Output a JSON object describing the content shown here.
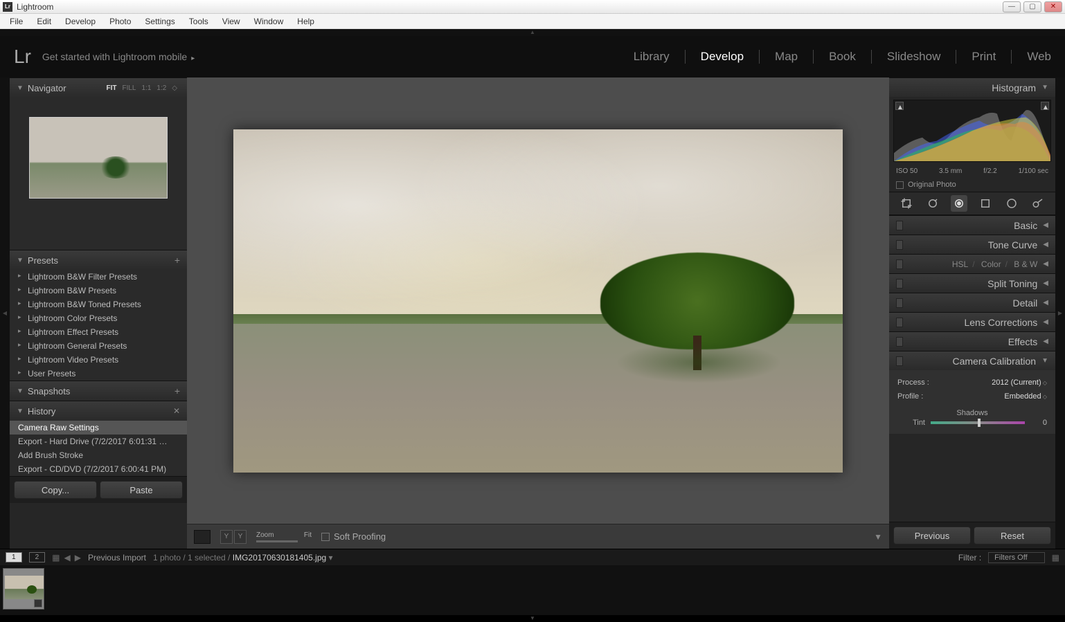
{
  "window": {
    "title": "Lightroom"
  },
  "menu": [
    "File",
    "Edit",
    "Develop",
    "Photo",
    "Settings",
    "Tools",
    "View",
    "Window",
    "Help"
  ],
  "topbar": {
    "logo": "Lr",
    "get_started": "Get started with Lightroom mobile",
    "modules": [
      "Library",
      "Develop",
      "Map",
      "Book",
      "Slideshow",
      "Print",
      "Web"
    ],
    "active_module": "Develop"
  },
  "left_panel": {
    "navigator": {
      "title": "Navigator",
      "zoom_options": [
        "FIT",
        "FILL",
        "1:1",
        "1:2"
      ],
      "active_zoom": "FIT"
    },
    "presets": {
      "title": "Presets",
      "items": [
        "Lightroom B&W Filter Presets",
        "Lightroom B&W Presets",
        "Lightroom B&W Toned Presets",
        "Lightroom Color Presets",
        "Lightroom Effect Presets",
        "Lightroom General Presets",
        "Lightroom Video Presets",
        "User Presets"
      ]
    },
    "snapshots": {
      "title": "Snapshots"
    },
    "history": {
      "title": "History",
      "items": [
        "Camera Raw Settings",
        "Export - Hard Drive (7/2/2017 6:01:31 …",
        "Add Brush Stroke",
        "Export - CD/DVD (7/2/2017 6:00:41 PM)"
      ],
      "active_index": 0
    },
    "buttons": {
      "copy": "Copy...",
      "paste": "Paste"
    }
  },
  "center": {
    "toolbar": {
      "zoom_label": "Zoom",
      "zoom_mode": "Fit",
      "soft_proofing": "Soft Proofing"
    }
  },
  "right_panel": {
    "histogram": {
      "title": "Histogram",
      "meta": {
        "iso": "ISO 50",
        "focal": "3.5 mm",
        "aperture": "f/2.2",
        "shutter": "1/100 sec"
      },
      "original_photo": "Original Photo"
    },
    "sections": {
      "basic": "Basic",
      "tone_curve": "Tone Curve",
      "hsl": "HSL",
      "color": "Color",
      "bw": "B & W",
      "split_toning": "Split Toning",
      "detail": "Detail",
      "lens_corrections": "Lens Corrections",
      "effects": "Effects",
      "camera_calibration": "Camera Calibration"
    },
    "calibration": {
      "process_label": "Process :",
      "process_value": "2012 (Current)",
      "profile_label": "Profile :",
      "profile_value": "Embedded",
      "shadows_label": "Shadows",
      "tint_label": "Tint",
      "tint_value": "0"
    },
    "buttons": {
      "previous": "Previous",
      "reset": "Reset"
    }
  },
  "filmstrip": {
    "badges": [
      "1",
      "2"
    ],
    "source": "Previous Import",
    "count": "1 photo / 1 selected /",
    "filename": "IMG20170630181405.jpg",
    "filter_label": "Filter :",
    "filter_value": "Filters Off"
  }
}
